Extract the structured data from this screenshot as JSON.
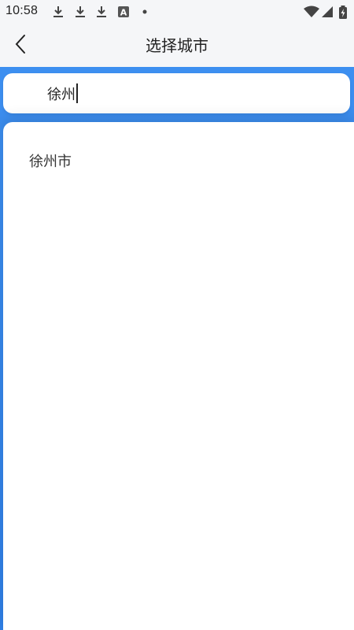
{
  "status_bar": {
    "time": "10:58",
    "icons": [
      "download-icon",
      "download-icon",
      "download-icon",
      "a-icon",
      "dot-icon",
      "wifi-icon",
      "signal-icon",
      "battery-icon"
    ]
  },
  "header": {
    "title": "选择城市",
    "back_icon": "chevron-left-icon"
  },
  "search": {
    "value": "徐州",
    "placeholder": ""
  },
  "results": [
    {
      "label": "徐州市"
    }
  ],
  "colors": {
    "accent": "#3d8ff0",
    "background": "#f5f6f8",
    "text": "#222222"
  }
}
